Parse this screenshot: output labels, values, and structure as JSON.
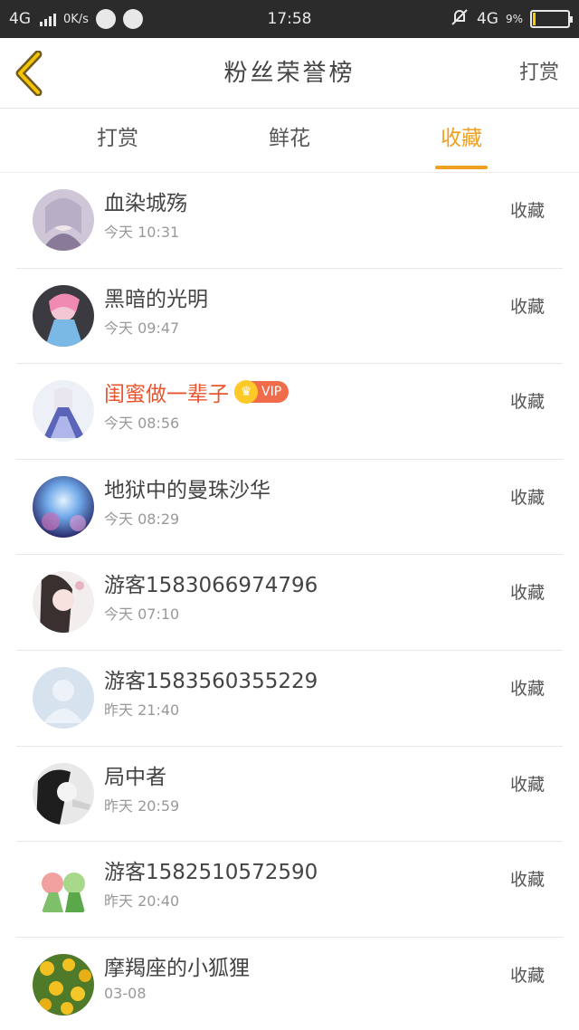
{
  "status_bar": {
    "network_left": "4G",
    "speed": "0K/s",
    "time": "17:58",
    "network_right": "4G",
    "battery_pct": "9%"
  },
  "header": {
    "title": "粉丝荣誉榜",
    "action": "打赏"
  },
  "tabs": [
    {
      "label": "打赏",
      "active": false
    },
    {
      "label": "鲜花",
      "active": false
    },
    {
      "label": "收藏",
      "active": true
    }
  ],
  "accent_color": "#f0a020",
  "vip_label": "VIP",
  "list": [
    {
      "name": "血染城殇",
      "time": "今天 10:31",
      "action": "收藏",
      "vip": false
    },
    {
      "name": "黑暗的光明",
      "time": "今天 09:47",
      "action": "收藏",
      "vip": false
    },
    {
      "name": "闺蜜做一辈子",
      "time": "今天 08:56",
      "action": "收藏",
      "vip": true
    },
    {
      "name": "地狱中的曼珠沙华",
      "time": "今天 08:29",
      "action": "收藏",
      "vip": false
    },
    {
      "name": "游客15830669747​96",
      "time": "今天 07:10",
      "action": "收藏",
      "vip": false
    },
    {
      "name": "游客15835603552​29",
      "time": "昨天 21:40",
      "action": "收藏",
      "vip": false
    },
    {
      "name": "局中者",
      "time": "昨天 20:59",
      "action": "收藏",
      "vip": false
    },
    {
      "name": "游客15825105725​90",
      "time": "昨天 20:40",
      "action": "收藏",
      "vip": false
    },
    {
      "name": "摩羯座的小狐狸",
      "time": "03-08",
      "action": "收藏",
      "vip": false
    }
  ]
}
